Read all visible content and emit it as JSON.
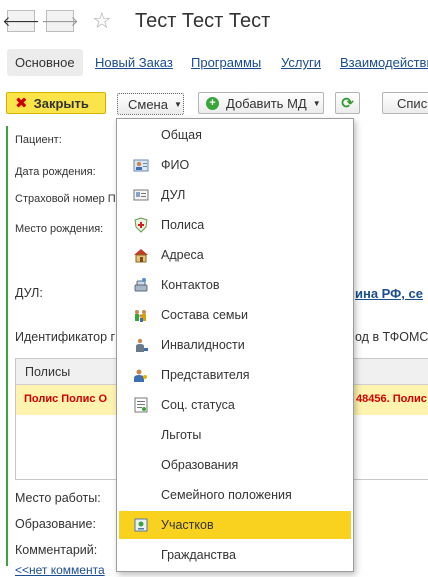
{
  "window": {
    "title": "Тест Тест Тест"
  },
  "nav": {
    "back": "🡐",
    "forward": "🡒",
    "star": "☆"
  },
  "tabs": [
    {
      "label": "Основное",
      "active": true
    },
    {
      "label": "Новый Заказ"
    },
    {
      "label": "Программы"
    },
    {
      "label": "Услуги"
    },
    {
      "label": "Взаимодействия"
    }
  ],
  "toolbar": {
    "close_label": "Закрыть",
    "change_label": "Смена",
    "add_md_label": "Добавить МД",
    "refresh_glyph": "⟳",
    "list_label": "Спис"
  },
  "form": {
    "patient_label": "Пациент:",
    "dob_label": "Дата рождения:",
    "insurance_label": "Страховой номер П",
    "birthplace_label": "Место рождения:",
    "dul_label": "ДУЛ:",
    "dul_link": "ина РФ, се",
    "identifier_label": "Идентификатор г",
    "identifier_tail": "од в ТФОМС",
    "policies_header": "Полисы",
    "policy_row_left": "Полис Полис О",
    "policy_row_right": "48456. Полис",
    "workplace_label": "Место работы:",
    "education_label": "Образование:",
    "comment_label": "Комментарий:",
    "no_comment": "<<нет коммента"
  },
  "menu": {
    "items": [
      {
        "label": "Общая",
        "icon": "none"
      },
      {
        "label": "ФИО",
        "icon": "person-card-icon"
      },
      {
        "label": "ДУЛ",
        "icon": "id-card-icon"
      },
      {
        "label": "Полиса",
        "icon": "shield-icon"
      },
      {
        "label": "Адреса",
        "icon": "house-icon"
      },
      {
        "label": "Контактов",
        "icon": "phone-icon"
      },
      {
        "label": "Состава семьи",
        "icon": "family-icon"
      },
      {
        "label": "Инвалидности",
        "icon": "disability-icon"
      },
      {
        "label": "Представителя",
        "icon": "representative-icon"
      },
      {
        "label": "Соц. статуса",
        "icon": "social-status-icon"
      },
      {
        "label": "Льготы",
        "icon": "none"
      },
      {
        "label": "Образования",
        "icon": "none"
      },
      {
        "label": "Семейного положения",
        "icon": "none"
      },
      {
        "label": "Участков",
        "icon": "district-icon",
        "selected": true
      },
      {
        "label": "Гражданства",
        "icon": "none"
      }
    ]
  },
  "colors": {
    "accent_yellow": "#f8d21e",
    "link_blue": "#1a4d8f",
    "green_bar": "#3aa53a",
    "policy_red": "#d40000",
    "policy_row_bg": "#fff3b0"
  }
}
